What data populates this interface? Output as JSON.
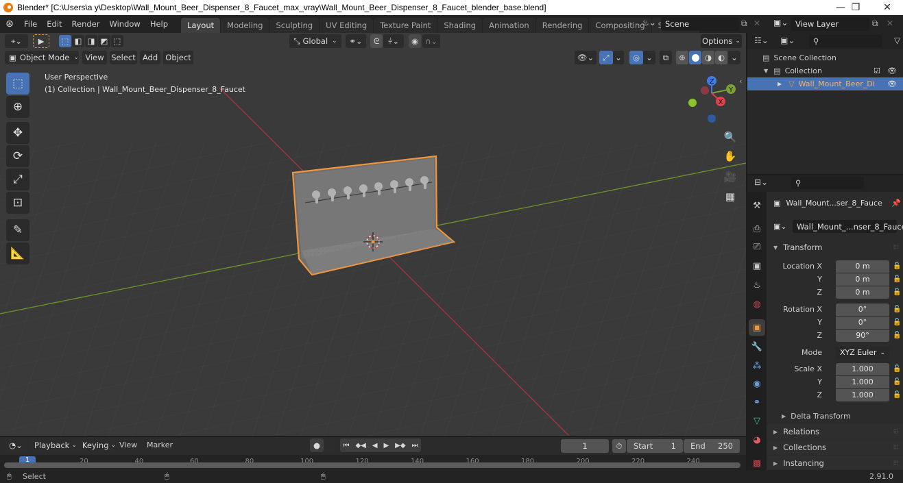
{
  "window": {
    "title": "Blender* [C:\\Users\\a y\\Desktop\\Wall_Mount_Beer_Dispenser_8_Faucet_max_vray\\Wall_Mount_Beer_Dispenser_8_Faucet_blender_base.blend]",
    "controls": {
      "minimize": "—",
      "restore": "❐",
      "close": "✕"
    }
  },
  "menu": [
    "File",
    "Edit",
    "Render",
    "Window",
    "Help"
  ],
  "workspaces": [
    "Layout",
    "Modeling",
    "Sculpting",
    "UV Editing",
    "Texture Paint",
    "Shading",
    "Animation",
    "Rendering",
    "Compositing",
    "Scripting"
  ],
  "active_workspace": "Layout",
  "add_workspace": "+",
  "scene": {
    "label": "Scene",
    "icon": "scene-icon"
  },
  "view_layer": {
    "label": "View Layer",
    "icon": "view-layer-icon"
  },
  "viewport": {
    "options_label": "Options",
    "transform_orientation": "Global",
    "mode": "Object Mode",
    "header_menus": [
      "View",
      "Select",
      "Add",
      "Object"
    ],
    "overlay_title": "User Perspective",
    "overlay_subtitle": "(1) Collection | Wall_Mount_Beer_Dispenser_8_Faucet",
    "tools": [
      "select-box-icon",
      "cursor-icon",
      "move-icon",
      "rotate-icon",
      "scale-icon",
      "transform-icon",
      "annotate-icon",
      "measure-icon"
    ],
    "gizmo": {
      "x": "X",
      "y": "Y",
      "z": "Z"
    },
    "nav_buttons": [
      "zoom-icon",
      "hand-pan-icon",
      "camera-icon",
      "grid-ortho-icon"
    ],
    "shading_active": "solid",
    "colors": {
      "x_axis": "#c8454f",
      "y_axis": "#7aa232",
      "selection": "#f0963c"
    }
  },
  "outliner": {
    "search_placeholder": "",
    "items": [
      {
        "label": "Scene Collection",
        "level": 0
      },
      {
        "label": "Collection",
        "level": 1,
        "checked": true,
        "visible": true
      },
      {
        "label": "Wall_Mount_Beer_Di",
        "level": 2,
        "selected": true,
        "visible": true
      }
    ]
  },
  "properties": {
    "search_placeholder": "",
    "object_name": "Wall_Mount...ser_8_Fauce",
    "mesh_name": "Wall_Mount_...nser_8_Faucet",
    "transform_label": "Transform",
    "location": {
      "label": "Location X",
      "x": "0 m",
      "y": "0 m",
      "z": "0 m"
    },
    "rotation": {
      "label": "Rotation X",
      "x": "0°",
      "y": "0°",
      "z": "90°"
    },
    "mode_label": "Mode",
    "mode_value": "XYZ Euler",
    "scale": {
      "label": "Scale X",
      "x": "1.000",
      "y": "1.000",
      "z": "1.000"
    },
    "axis_y": "Y",
    "axis_z": "Z",
    "delta_transform": "Delta Transform",
    "panels": [
      "Relations",
      "Collections",
      "Instancing"
    ],
    "tabs": [
      "tool-icon",
      "render-icon",
      "output-icon",
      "view-layer-icon",
      "scene-icon",
      "world-icon",
      "object-icon",
      "modifier-icon",
      "particles-icon",
      "physics-icon",
      "constraints-icon",
      "data-icon",
      "material-icon",
      "texture-icon"
    ],
    "active_tab": "object-icon"
  },
  "timeline": {
    "menus": [
      "Playback",
      "Keying",
      "View",
      "Marker"
    ],
    "current_frame": "1",
    "start_label": "Start",
    "start": "1",
    "end_label": "End",
    "end": "250",
    "ticks": [
      "1",
      "20",
      "40",
      "60",
      "80",
      "100",
      "120",
      "140",
      "160",
      "180",
      "200",
      "220",
      "240"
    ]
  },
  "statusbar": {
    "left": "Select",
    "version": "2.91.0"
  }
}
